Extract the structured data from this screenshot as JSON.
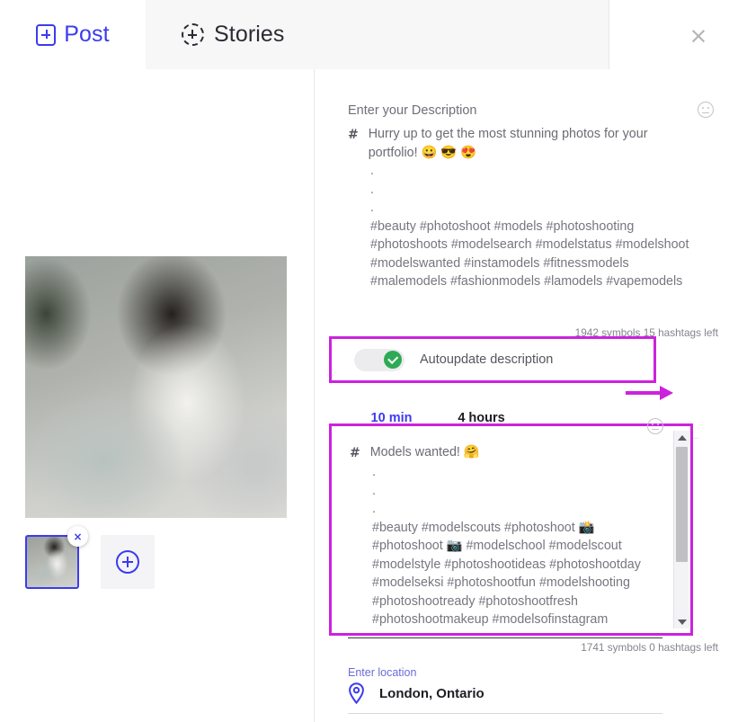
{
  "header": {
    "tabs": [
      {
        "label": "Post",
        "icon": "square-plus-icon",
        "active": false
      },
      {
        "label": "Stories",
        "icon": "dashed-circle-plus-icon",
        "active": true
      }
    ],
    "close_label": "×"
  },
  "left_panel": {
    "preview_alt": "post-image-preview",
    "thumbnail_remove_label": "×",
    "add_media_icon": "circle-plus-icon"
  },
  "description_primary": {
    "label": "Enter your Description",
    "emoji_icon": "smiley-icon",
    "hash_marker": "#",
    "headline": "Hurry up to get the most stunning photos for your portfolio! 😀 😎 😍",
    "spacer_lines": ".\n.\n.",
    "hashtags": "#beauty #photoshoot #models #photoshooting #photoshoots #modelsearch #modelstatus #modelshoot #modelswanted #instamodels #fitnessmodels #malemodels #fashionmodels #lamodels #vapemodels",
    "counter": "1942 symbols 15 hashtags left"
  },
  "autoupdate": {
    "label": "Autoupdate description",
    "enabled": true
  },
  "time_tabs": [
    {
      "label": "10 min",
      "active": true
    },
    {
      "label": "4 hours",
      "active": false
    }
  ],
  "description_secondary": {
    "emoji_icon": "smiley-icon",
    "hash_marker": "#",
    "headline": "Models wanted! 🤗",
    "spacer_lines": ".\n.\n.",
    "hashtags": "#beauty #modelscouts #photoshoot 📸 #photoshoot 📷 #modelschool #modelscout #modelstyle #photoshootideas #photoshootday #modelseksi #photoshootfun #modelshooting #photoshootready #photoshootfresh #photoshootmakeup #modelsofinstagram #modelslife #modelsneeded #foodphotoshoot",
    "counter": "1741 symbols 0 hashtags left",
    "scrollbar": {
      "up": "scroll-up-arrow",
      "down": "scroll-down-arrow"
    }
  },
  "location": {
    "label": "Enter location",
    "icon": "map-pin-icon",
    "value": "London, Ontario"
  },
  "colors": {
    "accent_blue": "#3b3bf0",
    "annotation_magenta": "#cc22dd",
    "toggle_green": "#2eaa54",
    "muted_text": "#76767f"
  }
}
